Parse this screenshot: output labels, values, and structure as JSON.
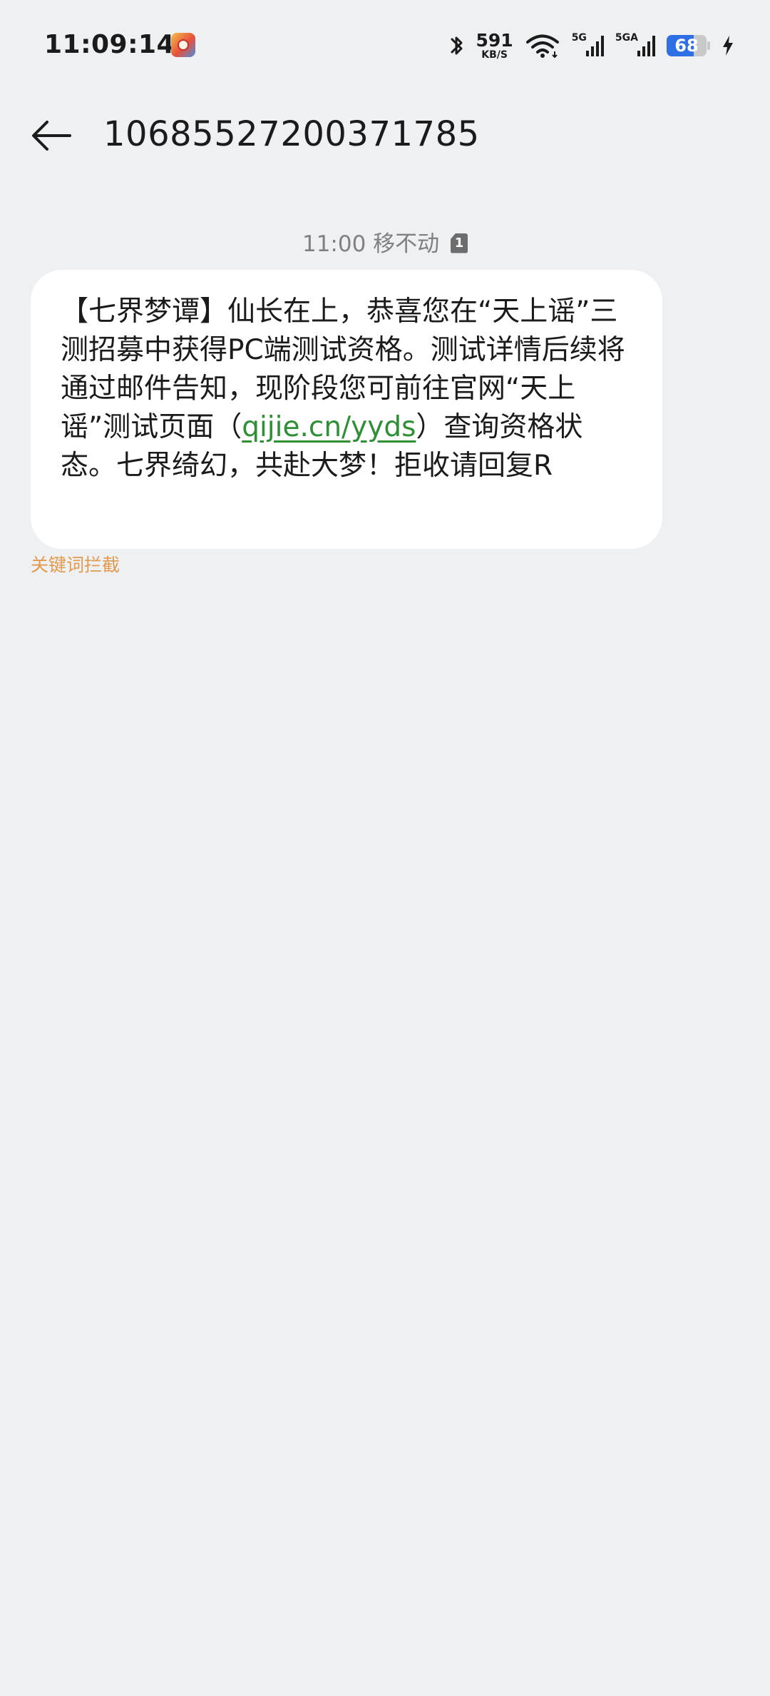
{
  "status_bar": {
    "time": "11:09:14",
    "net_speed_value": "591",
    "net_speed_unit": "KB/S",
    "sig1_label": "5G",
    "sig2_label": "5GA",
    "battery_level": "68"
  },
  "header": {
    "title": "10685527200371785"
  },
  "conversation": {
    "timestamp": "11:00",
    "carrier": "移不动",
    "sim_slot": "1",
    "message_parts": {
      "before_link": "【七界梦谭】仙长在上，恭喜您在“天上谣”三测招募中获得PC端测试资格。测试详情后续将通过邮件告知，现阶段您可前往官网“天上谣”测试页面（",
      "link": "qijie.cn/yyds",
      "after_link": "）查询资格状态。七界绮幻，共赴大梦！拒收请回复R"
    },
    "keyword_block_label": "关键词拦截"
  },
  "colors": {
    "background": "#eff0f2",
    "bubble": "#ffffff",
    "link": "#2f8f34",
    "keyword_block": "#e29a4e",
    "battery_fill": "#2f6fe6"
  }
}
